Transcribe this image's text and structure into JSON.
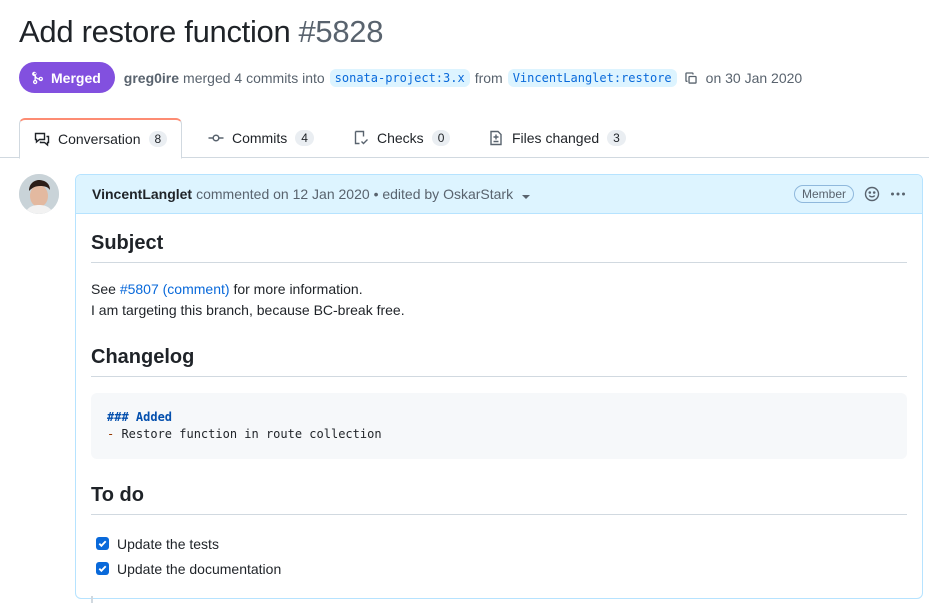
{
  "pr": {
    "title": "Add restore function",
    "number": "#5828",
    "status": "Merged",
    "merger": "greg0ire",
    "merge_text": "merged 4 commits into",
    "base_branch": "sonata-project:3.x",
    "from_text": "from",
    "head_branch": "VincentLanglet:restore",
    "date_text": "on 30 Jan 2020"
  },
  "tabs": [
    {
      "label": "Conversation",
      "count": "8",
      "icon": "comment-discussion-icon"
    },
    {
      "label": "Commits",
      "count": "4",
      "icon": "git-commit-icon"
    },
    {
      "label": "Checks",
      "count": "0",
      "icon": "checklist-icon"
    },
    {
      "label": "Files changed",
      "count": "3",
      "icon": "file-diff-icon"
    }
  ],
  "comment": {
    "author": "VincentLanglet",
    "meta": "commented on 12 Jan 2020",
    "edited": "• edited by OskarStark",
    "role": "Member",
    "subject_heading": "Subject",
    "see_text": "See",
    "issue_link": "#5807",
    "comment_link": "(comment)",
    "more_info": "for more information.",
    "branch_reason": "I am targeting this branch, because BC-break free.",
    "changelog_heading": "Changelog",
    "code_line1": "### Added",
    "code_line2_dash": "-",
    "code_line2": " Restore function in route collection",
    "todo_heading": "To do",
    "tasks": [
      "Update the tests",
      "Update the documentation"
    ]
  },
  "colors": {
    "merged": "#8250df",
    "link": "#0969da",
    "comment_header_bg": "#ddf4ff",
    "active_tab_accent": "#fd8c73"
  }
}
